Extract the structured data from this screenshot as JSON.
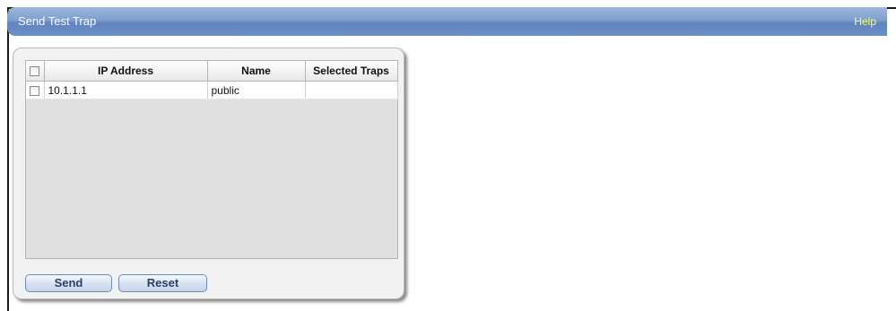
{
  "header": {
    "title": "Send Test Trap",
    "help_label": "Help"
  },
  "table": {
    "columns": [
      "IP Address",
      "Name",
      "Selected Traps"
    ],
    "rows": [
      {
        "ip": "10.1.1.1",
        "name": "public",
        "traps": ""
      }
    ]
  },
  "buttons": {
    "send": "Send",
    "reset": "Reset"
  },
  "colors": {
    "titlebar": "#6d90c6",
    "help_link": "#ffff66",
    "button_text": "#2d3e6b"
  }
}
